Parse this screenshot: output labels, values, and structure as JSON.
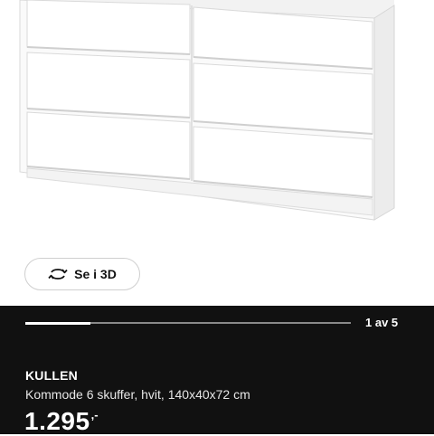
{
  "viewer": {
    "view_3d_label": "Se i 3D",
    "view_3d_icon": "rotate-3d-icon"
  },
  "gallery": {
    "current_index": 1,
    "total": 5,
    "counter_text": "1 av 5",
    "progress_fraction": 0.2
  },
  "product": {
    "name": "KULLEN",
    "description": "Kommode 6 skuffer, hvit, 140x40x72 cm",
    "price": "1.295",
    "price_suffix": ",-"
  },
  "colors": {
    "panel_background": "#111111",
    "text_primary": "#ffffff"
  }
}
